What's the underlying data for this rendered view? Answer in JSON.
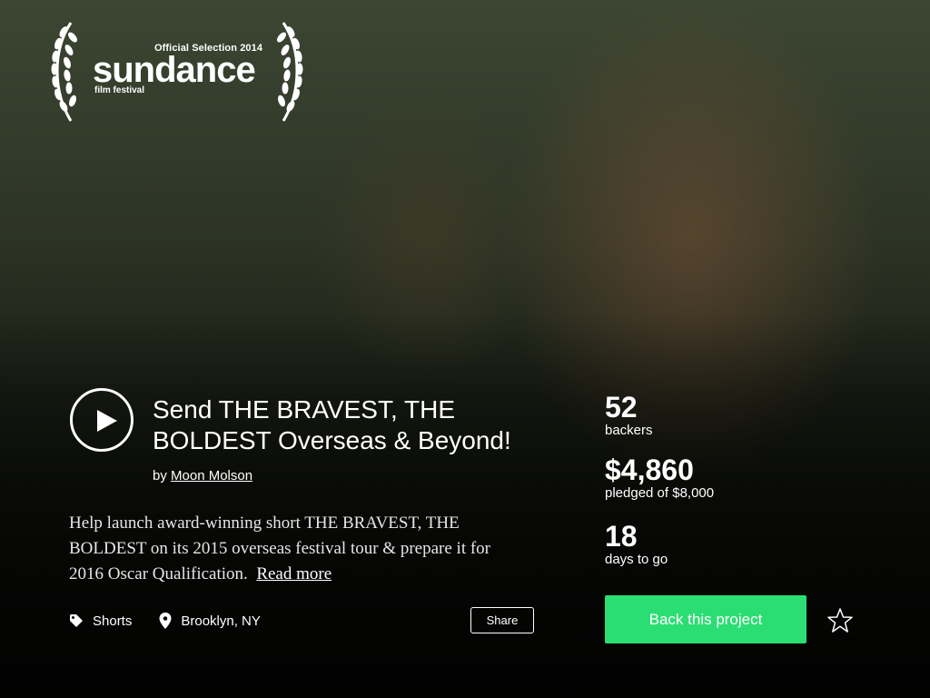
{
  "festival": {
    "selection_label": "Official Selection 2014",
    "brand_name": "sundance",
    "brand_subtitle": "film festival"
  },
  "project": {
    "title": "Send THE BRAVEST, THE BOLDEST Overseas & Beyond!",
    "by_prefix": "by",
    "creator": "Moon Molson",
    "blurb": "Help launch award-winning short THE BRAVEST, THE BOLDEST on its 2015 overseas festival tour & prepare it for 2016 Oscar Qualification.",
    "read_more": "Read more",
    "category": "Shorts",
    "location": "Brooklyn, NY",
    "share_label": "Share"
  },
  "stats": {
    "backers_count": "52",
    "backers_label": "backers",
    "pledged_amount": "$4,860",
    "pledged_label": "pledged of $8,000",
    "days_count": "18",
    "days_label": "days to go"
  },
  "actions": {
    "back_label": "Back this project"
  },
  "colors": {
    "accent": "#2bde73",
    "text": "#ffffff"
  },
  "icons": {
    "play": "play-icon",
    "tag": "tag-icon",
    "location": "location-pin-icon",
    "star": "star-outline-icon"
  }
}
